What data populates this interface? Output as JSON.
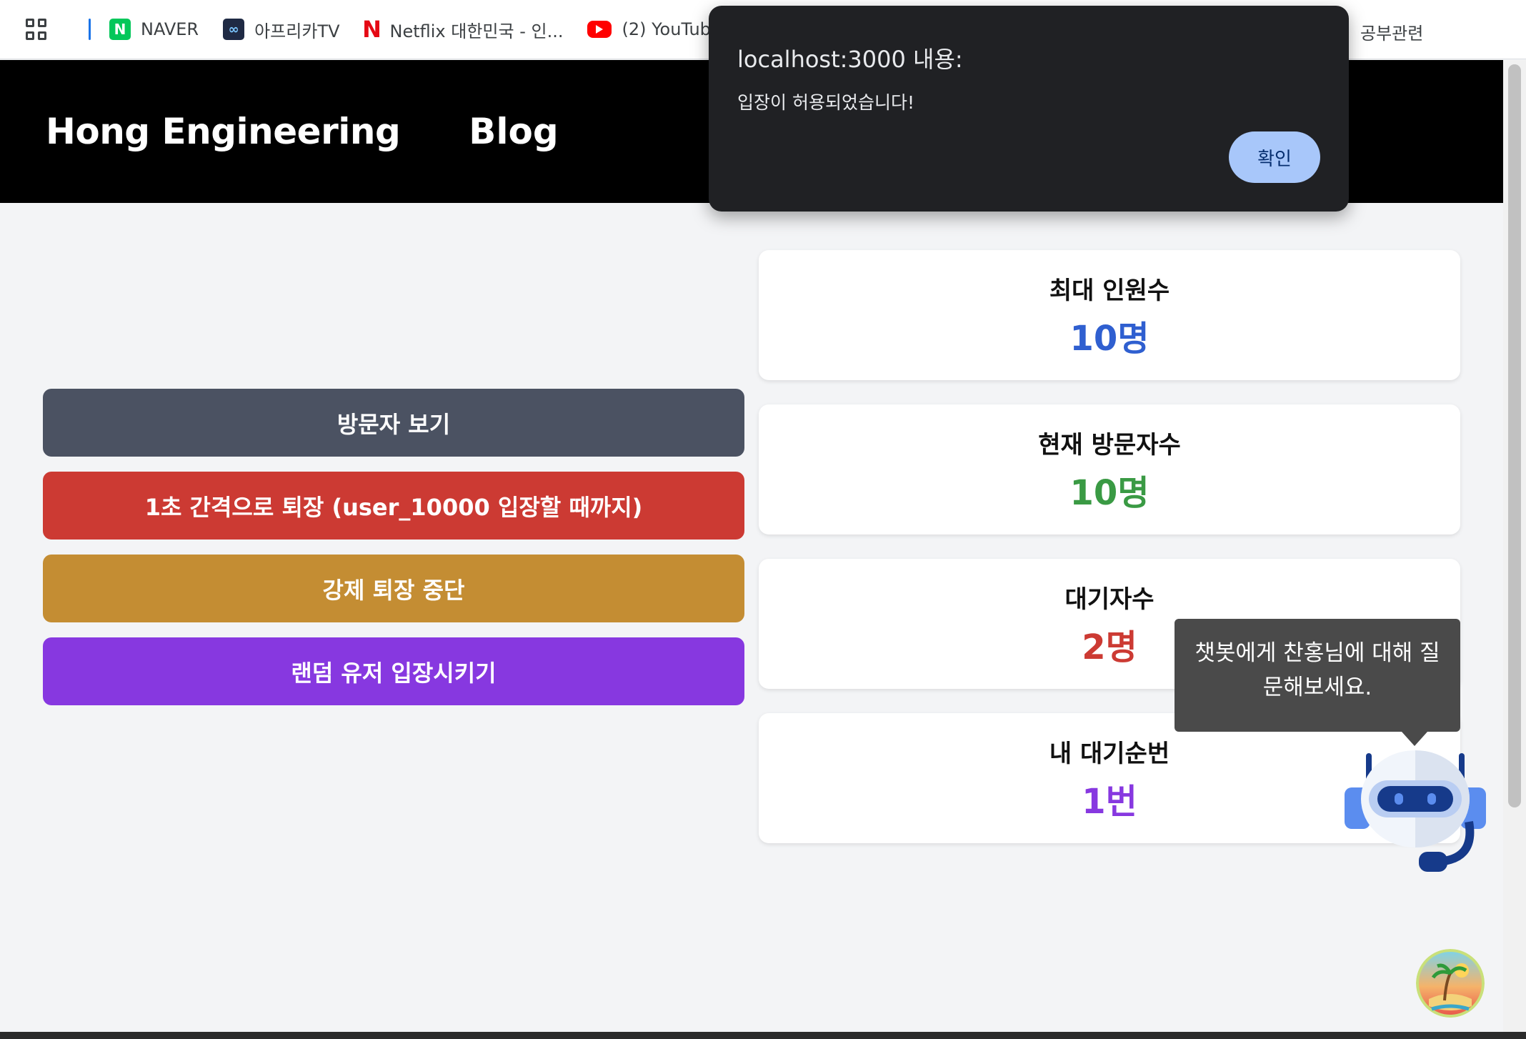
{
  "bookmarks": {
    "items": [
      {
        "label": "NAVER",
        "icon": "naver-icon"
      },
      {
        "label": "아프리카TV",
        "icon": "afreecatv-icon"
      },
      {
        "label": "Netflix 대한민국 - 인...",
        "icon": "netflix-icon"
      },
      {
        "label": "(2) YouTube",
        "icon": "youtube-icon"
      }
    ],
    "right_label": "공부관련"
  },
  "header": {
    "brand": "Hong Engineering",
    "nav_blog": "Blog"
  },
  "actions": {
    "view_visitors": "방문자 보기",
    "exit_interval": "1초 간격으로 퇴장 (user_10000 입장할 때까지)",
    "stop_force_exit": "강제 퇴장 중단",
    "random_enter": "랜덤 유저 입장시키기"
  },
  "stats": {
    "max_capacity": {
      "label": "최대 인원수",
      "value": "10명",
      "color": "#2f5fd0"
    },
    "current_visitors": {
      "label": "현재 방문자수",
      "value": "10명",
      "color": "#3a9a44"
    },
    "waiting": {
      "label": "대기자수",
      "value": "2명",
      "color": "#cc3a33"
    },
    "my_position": {
      "label": "내 대기순번",
      "value": "1번",
      "color": "#8738e0"
    }
  },
  "dialog": {
    "title": "localhost:3000 내용:",
    "message": "입장이 허용되었습니다!",
    "ok_label": "확인"
  },
  "chatbot": {
    "tooltip_line1": "챗봇에게 찬홍님에 대해 질",
    "tooltip_line2": "문해보세요."
  }
}
